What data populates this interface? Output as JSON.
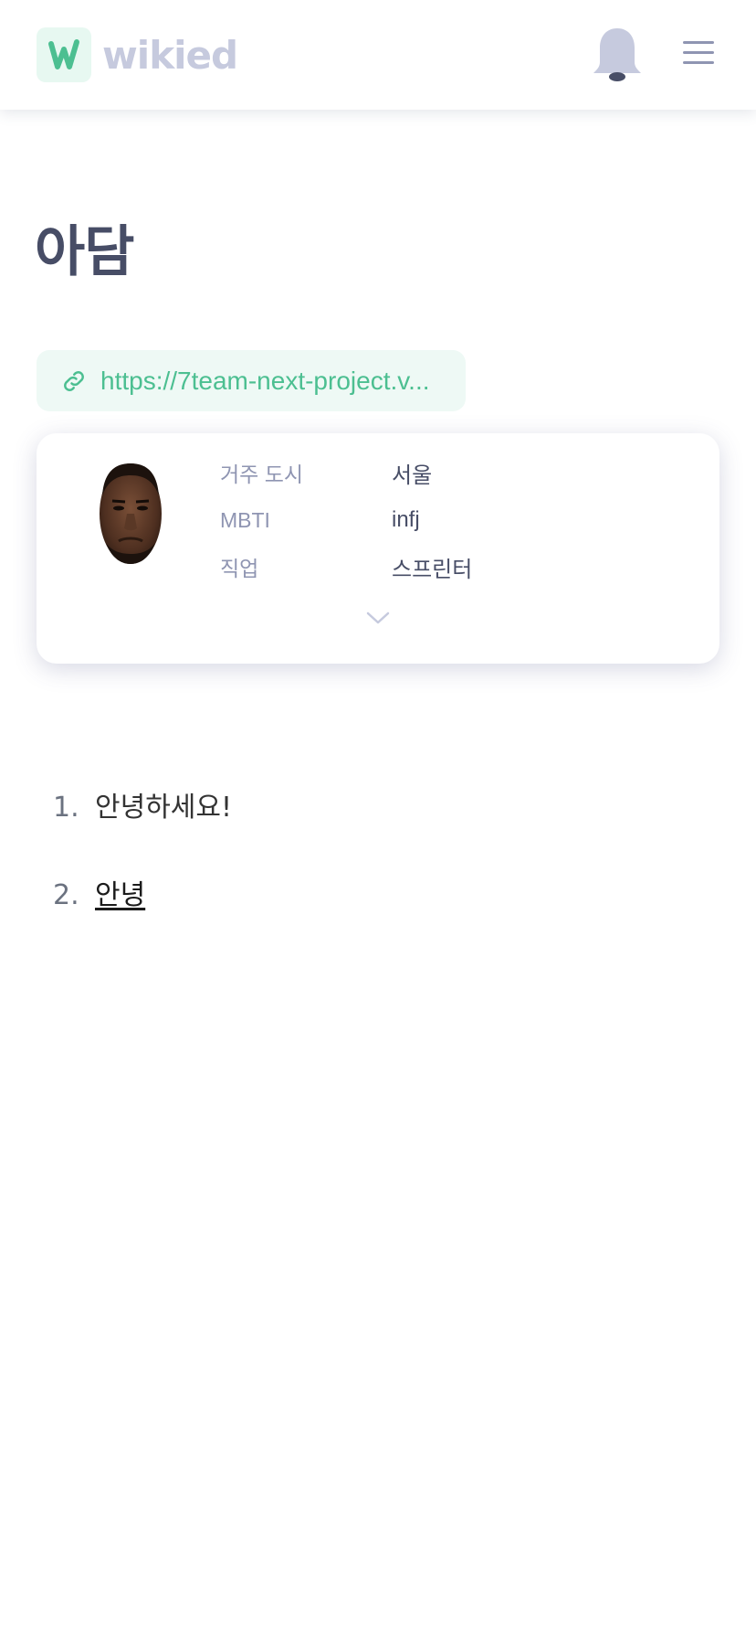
{
  "header": {
    "logo_text": "wikied",
    "logo_letter": "W",
    "icons": [
      "bell-icon",
      "hamburger-menu-icon"
    ],
    "colors": {
      "brand": "#4cbf91",
      "logo_text": "#c6cade",
      "icon": "#c6cade"
    }
  },
  "page": {
    "title": "아담"
  },
  "wiki_link": {
    "text": "https://7team-next-project.v..."
  },
  "profile": {
    "avatar_icon": "avatar-photo",
    "fields": [
      {
        "label": "거주 도시",
        "value": "서울"
      },
      {
        "label": "MBTI",
        "value": "infj"
      },
      {
        "label": "직업",
        "value": "스프린터"
      }
    ],
    "expand_icon": "chevron-down-icon"
  },
  "content": {
    "items": [
      {
        "num": "1.",
        "text": "안녕하세요!"
      },
      {
        "num": "2.",
        "text": "안녕"
      }
    ]
  }
}
